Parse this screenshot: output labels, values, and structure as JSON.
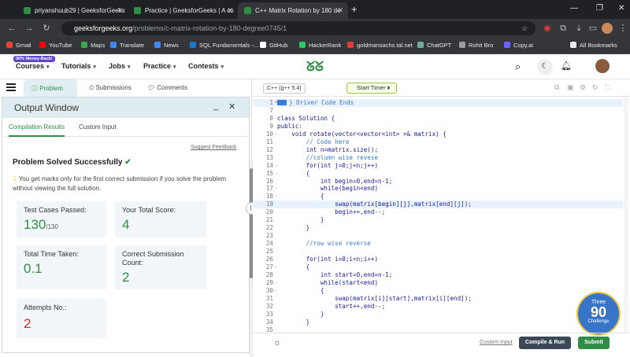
{
  "browser": {
    "tabs": [
      {
        "label": "priyanshuub29 | GeeksforGeeks"
      },
      {
        "label": "Practice | GeeksforGeeks | A co"
      },
      {
        "label": "C++ Matrix Rotation by 180 de"
      }
    ],
    "url_host": "geeksforgeeks.org",
    "url_path": "/problems/c-matrix-rotation-by-180-degree0745/1",
    "bookmarks": [
      {
        "label": "Gmail",
        "color": "#ea4335"
      },
      {
        "label": "YouTube",
        "color": "#ff0000"
      },
      {
        "label": "Maps",
        "color": "#34a853"
      },
      {
        "label": "Translate",
        "color": "#4285f4"
      },
      {
        "label": "News",
        "color": "#4285f4"
      },
      {
        "label": "SQL Fundamentals -...",
        "color": "#1976d2"
      },
      {
        "label": "GitHub",
        "color": "#ffffff"
      },
      {
        "label": "HackerRank",
        "color": "#2ec866"
      },
      {
        "label": "goldmansachs.tal.net",
        "color": "#e53935"
      },
      {
        "label": "ChatGPT",
        "color": "#74aa9c"
      },
      {
        "label": "Rohit Bro",
        "color": "#9e9e9e"
      },
      {
        "label": "Copy.ai",
        "color": "#6c63ff"
      }
    ],
    "all_bookmarks": "All Bookmarks"
  },
  "header": {
    "promo": "90% Money-Back!",
    "menus": [
      "Courses",
      "Tutorials",
      "Jobs",
      "Practice",
      "Contests"
    ],
    "logo": "GfG",
    "accent": "#2f8d46"
  },
  "problem_tabs": {
    "problem": "Problem",
    "submissions": "Submissions",
    "comments": "Comments"
  },
  "output": {
    "title": "Output Window",
    "tabs": [
      "Compilation Results",
      "Custom Input"
    ],
    "suggest": "Suggest Feedback",
    "status": "Problem Solved Successfully",
    "note": "You get marks only for the first correct submission if you solve the problem without viewing the full solution.",
    "cards": {
      "tests_label": "Test Cases Passed:",
      "tests_value": "130",
      "tests_total": "/130",
      "score_label": "Your Total Score:",
      "score_value": "4",
      "time_label": "Total Time Taken:",
      "time_value": "0.1",
      "correct_label": "Correct Submission Count:",
      "correct_value": "2",
      "attempts_label": "Attempts No.:",
      "attempts_value": "2"
    }
  },
  "editor": {
    "language": "C++ (g++ 5.4)",
    "timer": "Start Timer",
    "custom_input": "Custom Input",
    "compile": "Compile & Run",
    "submit": "Submit",
    "badge": {
      "top": "Three",
      "num": "90",
      "bottom": "Challenge"
    },
    "lines": [
      {
        "n": "1",
        "fold": "+",
        "code": "} Driver Code Ends",
        "hl": true
      },
      {
        "n": "7",
        "fold": "",
        "code": ""
      },
      {
        "n": "8",
        "fold": "-",
        "code": "class Solution {"
      },
      {
        "n": "9",
        "fold": "",
        "code": "public:"
      },
      {
        "n": "10",
        "fold": "-",
        "code": "    void rotate(vector<vector<int> >& matrix) {"
      },
      {
        "n": "11",
        "fold": "",
        "code": "        // Code here"
      },
      {
        "n": "12",
        "fold": "",
        "code": "        int n=matrix.size();"
      },
      {
        "n": "13",
        "fold": "",
        "code": "        //column wise revese"
      },
      {
        "n": "14",
        "fold": "-",
        "code": "        for(int j=0;j<n;j++)"
      },
      {
        "n": "15",
        "fold": "-",
        "code": "        {"
      },
      {
        "n": "16",
        "fold": "",
        "code": "            int begin=0,end=n-1;"
      },
      {
        "n": "17",
        "fold": "-",
        "code": "            while(begin<end)"
      },
      {
        "n": "18",
        "fold": "-",
        "code": "            {"
      },
      {
        "n": "19",
        "fold": "",
        "code": "                swap(matrix[begin][j],matrix[end][j]);",
        "hl": true
      },
      {
        "n": "20",
        "fold": "",
        "code": "                begin++,end--;"
      },
      {
        "n": "21",
        "fold": "",
        "code": "            }"
      },
      {
        "n": "22",
        "fold": "",
        "code": "        }"
      },
      {
        "n": "23",
        "fold": "",
        "code": ""
      },
      {
        "n": "24",
        "fold": "",
        "code": "        //row wise reverse"
      },
      {
        "n": "25",
        "fold": "",
        "code": ""
      },
      {
        "n": "26",
        "fold": "",
        "code": "        for(int i=0;i<n;i++)"
      },
      {
        "n": "27",
        "fold": "-",
        "code": "        {"
      },
      {
        "n": "28",
        "fold": "",
        "code": "            int start=0,end=n-1;"
      },
      {
        "n": "29",
        "fold": "-",
        "code": "            while(start<end)"
      },
      {
        "n": "30",
        "fold": "-",
        "code": "            {"
      },
      {
        "n": "31",
        "fold": "",
        "code": "                swap(matrix[i][start],matrix[i][end]);"
      },
      {
        "n": "32",
        "fold": "",
        "code": "                start++,end--;"
      },
      {
        "n": "33",
        "fold": "",
        "code": "            }"
      },
      {
        "n": "34",
        "fold": "",
        "code": "        }"
      },
      {
        "n": "35",
        "fold": "",
        "code": ""
      }
    ]
  }
}
